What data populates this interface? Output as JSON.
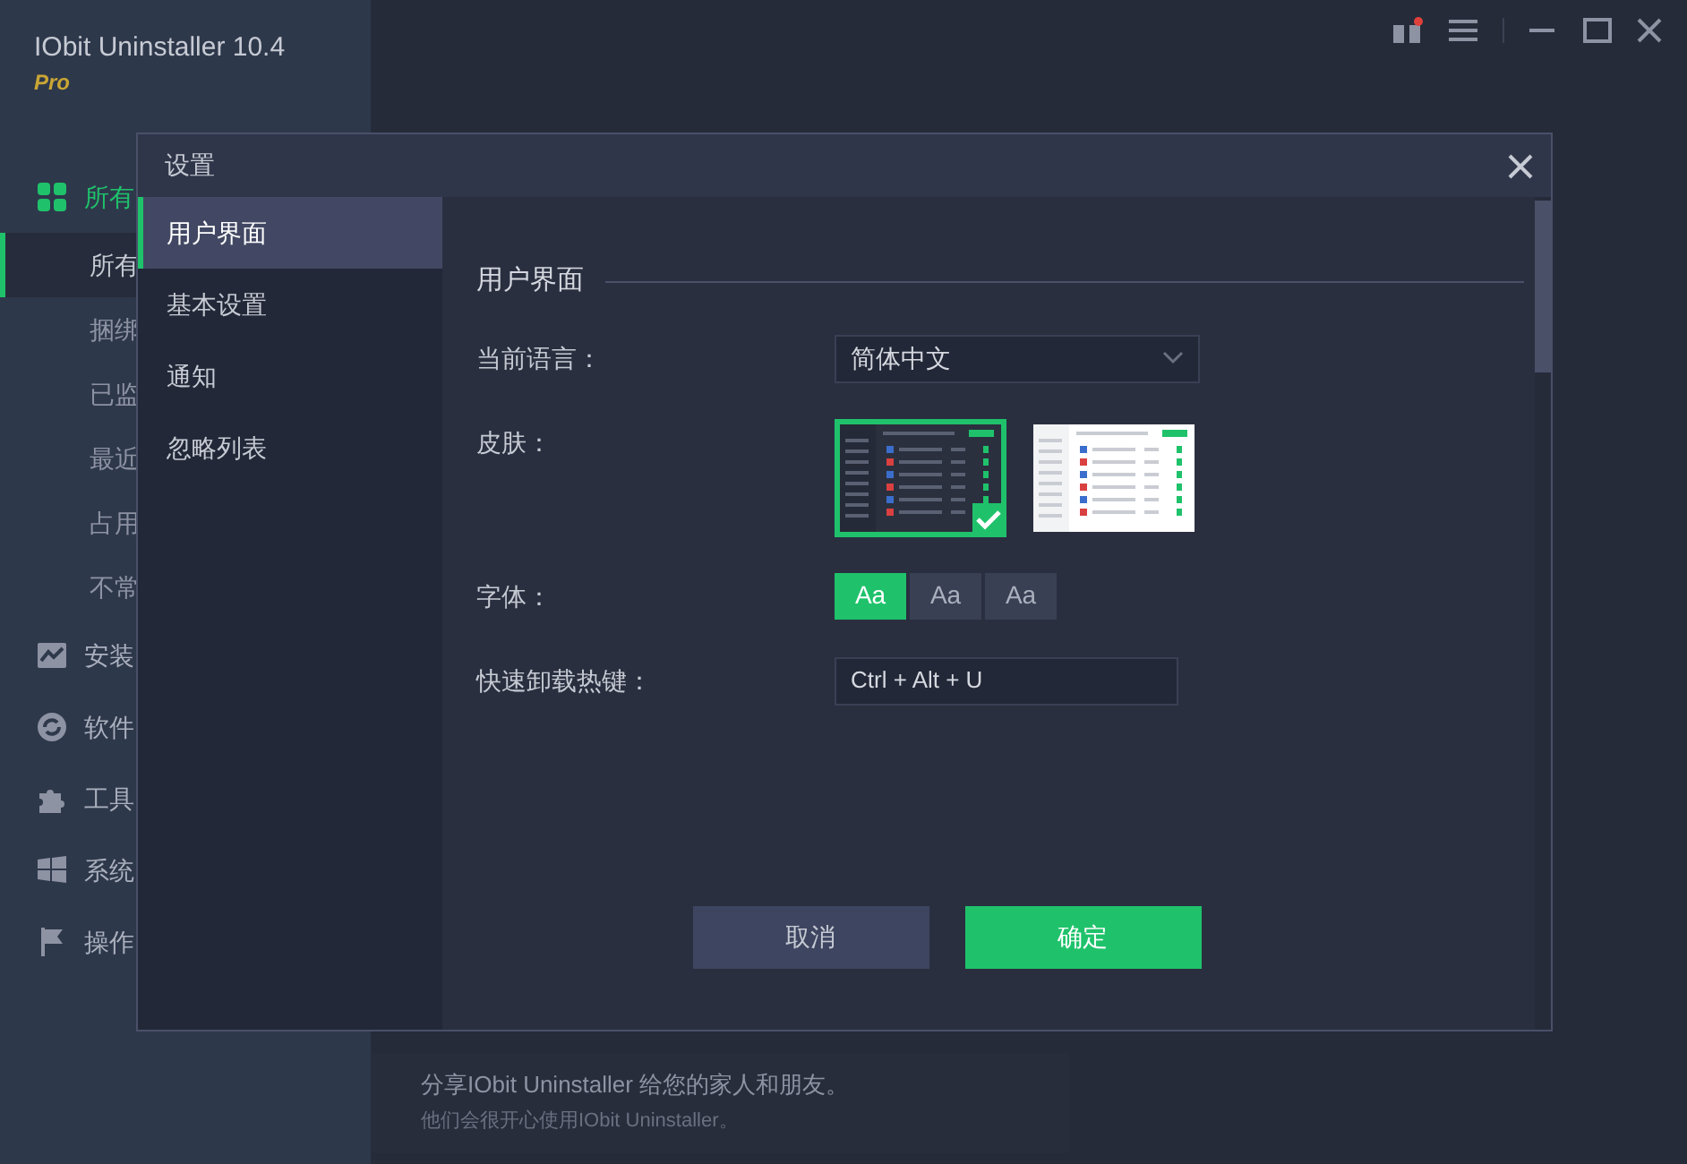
{
  "app": {
    "title": "IObit Uninstaller 10.4",
    "edition": "Pro"
  },
  "sidebar": {
    "items": [
      {
        "label": "所有",
        "selected": true,
        "children": [
          {
            "label": "所有",
            "selected": true
          },
          {
            "label": "捆绑",
            "selected": false
          },
          {
            "label": "已监",
            "selected": false
          },
          {
            "label": "最近",
            "selected": false
          },
          {
            "label": "占用",
            "selected": false
          },
          {
            "label": "不常",
            "selected": false
          }
        ]
      },
      {
        "label": "安装",
        "selected": false
      },
      {
        "label": "软件",
        "selected": false
      },
      {
        "label": "工具",
        "selected": false
      },
      {
        "label": "系统",
        "selected": false
      },
      {
        "label": "操作",
        "selected": false
      }
    ]
  },
  "banner": {
    "line_1": "分享IObit Uninstaller 给您的家人和朋友。",
    "line_2": "他们会很开心使用IObit Uninstaller。"
  },
  "dialog": {
    "title": "设置",
    "nav": [
      {
        "label": "用户界面",
        "selected": true
      },
      {
        "label": "基本设置",
        "selected": false
      },
      {
        "label": "通知",
        "selected": false
      },
      {
        "label": "忽略列表",
        "selected": false
      }
    ],
    "section_title": "用户界面",
    "fields": [
      {
        "kind": "select",
        "label": "当前语言：",
        "value": "简体中文"
      },
      {
        "kind": "skins",
        "label": "皮肤：",
        "options": [
          {
            "kind": "dark",
            "selected": true
          },
          {
            "kind": "light",
            "selected": false
          }
        ]
      },
      {
        "kind": "fonts",
        "label": "字体：",
        "options": [
          {
            "label": "Aa",
            "selected": true
          },
          {
            "label": "Aa",
            "selected": false
          },
          {
            "label": "Aa",
            "selected": false
          }
        ]
      },
      {
        "kind": "hotkey",
        "label": "快速卸载热键：",
        "value": "Ctrl + Alt + U"
      }
    ],
    "buttons": [
      {
        "label": "取消",
        "kind": "secondary"
      },
      {
        "label": "确定",
        "kind": "primary"
      }
    ]
  }
}
